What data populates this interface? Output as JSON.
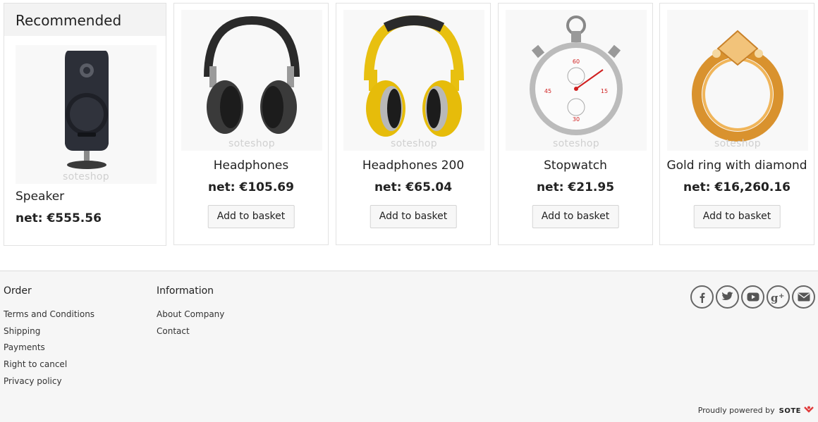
{
  "recommended": {
    "title": "Recommended",
    "product": {
      "name": "Speaker",
      "price": "net: €555.56",
      "watermark": "soteshop",
      "icon": "speaker-image"
    }
  },
  "products": [
    {
      "name": "Headphones",
      "price": "net: €105.69",
      "button": "Add to basket",
      "watermark": "soteshop",
      "icon": "headphones-black-image"
    },
    {
      "name": "Headphones 200",
      "price": "net: €65.04",
      "button": "Add to basket",
      "watermark": "soteshop",
      "icon": "headphones-yellow-image"
    },
    {
      "name": "Stopwatch",
      "price": "net: €21.95",
      "button": "Add to basket",
      "watermark": "soteshop",
      "icon": "stopwatch-image"
    },
    {
      "name": "Gold ring with diamond",
      "price": "net: €16,260.16",
      "button": "Add to basket",
      "watermark": "soteshop",
      "icon": "gold-ring-image"
    }
  ],
  "footer": {
    "order": {
      "title": "Order",
      "links": [
        "Terms and Conditions",
        "Shipping",
        "Payments",
        "Right to cancel",
        "Privacy policy"
      ]
    },
    "information": {
      "title": "Information",
      "links": [
        "About Company",
        "Contact"
      ]
    },
    "social": [
      "facebook-icon",
      "twitter-icon",
      "youtube-icon",
      "google-plus-icon",
      "email-icon"
    ],
    "powered_by": "Proudly powered by",
    "brand": "SOTE"
  },
  "colors": {
    "accent": "#e03a3a",
    "border": "#e2e2e2",
    "footer_bg": "#f6f6f6"
  }
}
